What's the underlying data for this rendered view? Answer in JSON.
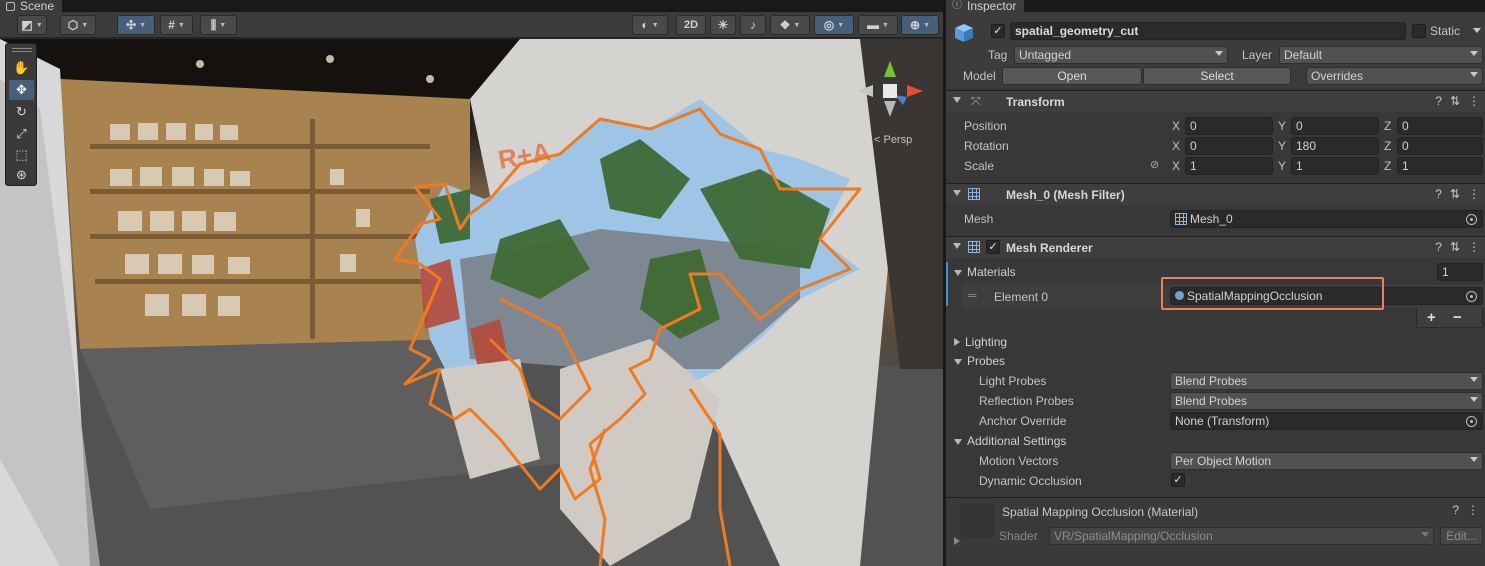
{
  "scene": {
    "tab_label": "Scene",
    "toolbar": {
      "btn_2d": "2D"
    },
    "persp_label": "< Persp"
  },
  "inspector": {
    "tab_label": "Inspector",
    "object_name": "spatial_geometry_cut",
    "static_label": "Static",
    "tag_label": "Tag",
    "tag_value": "Untagged",
    "layer_label": "Layer",
    "layer_value": "Default",
    "model_label": "Model",
    "open_button": "Open",
    "select_button": "Select",
    "overrides_value": "Overrides",
    "transform": {
      "title": "Transform",
      "position_label": "Position",
      "rotation_label": "Rotation",
      "scale_label": "Scale",
      "axis_x": "X",
      "axis_y": "Y",
      "axis_z": "Z",
      "position": {
        "x": "0",
        "y": "0",
        "z": "0"
      },
      "rotation": {
        "x": "0",
        "y": "180",
        "z": "0"
      },
      "scale": {
        "x": "1",
        "y": "1",
        "z": "1"
      }
    },
    "mesh_filter": {
      "title": "Mesh_0 (Mesh Filter)",
      "mesh_label": "Mesh",
      "mesh_value": "Mesh_0"
    },
    "mesh_renderer": {
      "title": "Mesh Renderer",
      "materials_label": "Materials",
      "materials_count": "1",
      "element_label": "Element 0",
      "element_value": "SpatialMappingOcclusion",
      "add_button": "+",
      "remove_button": "−",
      "lighting_label": "Lighting",
      "probes_label": "Probes",
      "light_probes_label": "Light Probes",
      "light_probes_value": "Blend Probes",
      "reflection_probes_label": "Reflection Probes",
      "reflection_probes_value": "Blend Probes",
      "anchor_override_label": "Anchor Override",
      "anchor_override_value": "None (Transform)",
      "additional_settings_label": "Additional Settings",
      "motion_vectors_label": "Motion Vectors",
      "motion_vectors_value": "Per Object Motion",
      "dynamic_occlusion_label": "Dynamic Occlusion",
      "dynamic_occlusion_checked": "✓"
    },
    "material": {
      "title": "Spatial Mapping Occlusion (Material)",
      "shader_label": "Shader",
      "shader_value": "VR/SpatialMapping/Occlusion",
      "edit_button": "Edit..."
    },
    "colors": {
      "highlight": "#e8825a",
      "selection_outline": "#f07a1e",
      "active_tool": "#46607c"
    }
  }
}
